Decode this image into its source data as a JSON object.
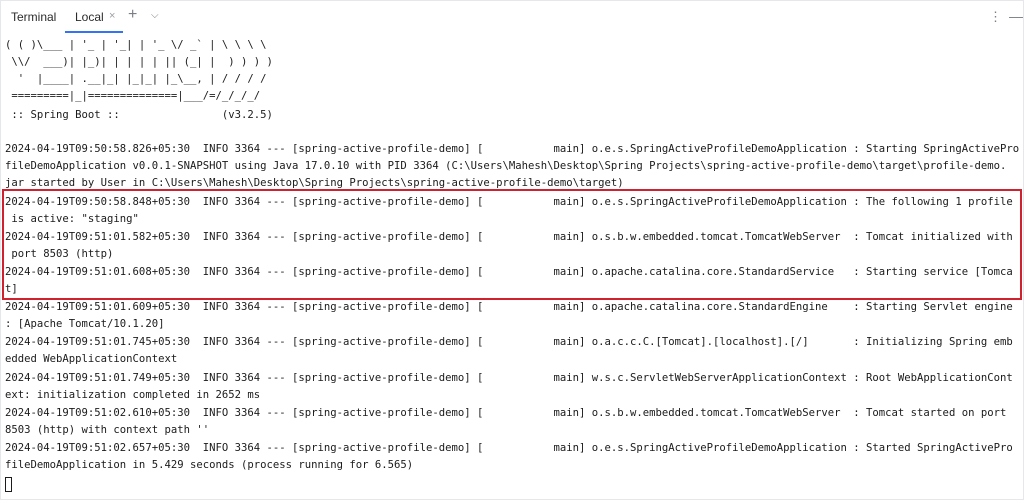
{
  "tabbar": {
    "title": "Terminal",
    "tabs": [
      {
        "label": "Local",
        "close_icon": "×"
      }
    ],
    "add_tab_icon": "+",
    "dropdown_icon": "⌵",
    "options_icon": "⋮",
    "minimize_icon": "—"
  },
  "console": {
    "banner": [
      "( ( )\\___ | '_ | '_| | '_ \\/ _` | \\ \\ \\ \\",
      " \\\\/  ___)| |_)| | | | | || (_| |  ) ) ) )",
      "  '  |____| .__|_| |_|_| |_\\__, | / / / /",
      " =========|_|==============|___/=/_/_/_/",
      " :: Spring Boot ::                (v3.2.5)"
    ],
    "log_lines": [
      "2024-04-19T09:50:58.826+05:30  INFO 3364 --- [spring-active-profile-demo] [           main] o.e.s.SpringActiveProfileDemoApplication : Starting SpringActivePro",
      "fileDemoApplication v0.0.1-SNAPSHOT using Java 17.0.10 with PID 3364 (C:\\Users\\Mahesh\\Desktop\\Spring Projects\\spring-active-profile-demo\\target\\profile-demo.",
      "jar started by User in C:\\Users\\Mahesh\\Desktop\\Spring Projects\\spring-active-profile-demo\\target)",
      "2024-04-19T09:50:58.848+05:30  INFO 3364 --- [spring-active-profile-demo] [           main] o.e.s.SpringActiveProfileDemoApplication : The following 1 profile",
      " is active: \"staging\"",
      "2024-04-19T09:51:01.582+05:30  INFO 3364 --- [spring-active-profile-demo] [           main] o.s.b.w.embedded.tomcat.TomcatWebServer  : Tomcat initialized with",
      " port 8503 (http)",
      "2024-04-19T09:51:01.608+05:30  INFO 3364 --- [spring-active-profile-demo] [           main] o.apache.catalina.core.StandardService   : Starting service [Tomca",
      "t]",
      "2024-04-19T09:51:01.609+05:30  INFO 3364 --- [spring-active-profile-demo] [           main] o.apache.catalina.core.StandardEngine    : Starting Servlet engine",
      ": [Apache Tomcat/10.1.20]",
      "2024-04-19T09:51:01.745+05:30  INFO 3364 --- [spring-active-profile-demo] [           main] o.a.c.c.C.[Tomcat].[localhost].[/]       : Initializing Spring emb",
      "edded WebApplicationContext",
      "2024-04-19T09:51:01.749+05:30  INFO 3364 --- [spring-active-profile-demo] [           main] w.s.c.ServletWebServerApplicationContext : Root WebApplicationCont",
      "ext: initialization completed in 2652 ms",
      "2024-04-19T09:51:02.610+05:30  INFO 3364 --- [spring-active-profile-demo] [           main] o.s.b.w.embedded.tomcat.TomcatWebServer  : Tomcat started on port",
      "8503 (http) with context path ''",
      "2024-04-19T09:51:02.657+05:30  INFO 3364 --- [spring-active-profile-demo] [           main] o.e.s.SpringActiveProfileDemoApplication : Started SpringActivePro",
      "fileDemoApplication in 5.429 seconds (process running for 6.565)"
    ]
  },
  "colors": {
    "highlight_border": "#d0222e",
    "active_tab_underline": "#3574f0"
  }
}
